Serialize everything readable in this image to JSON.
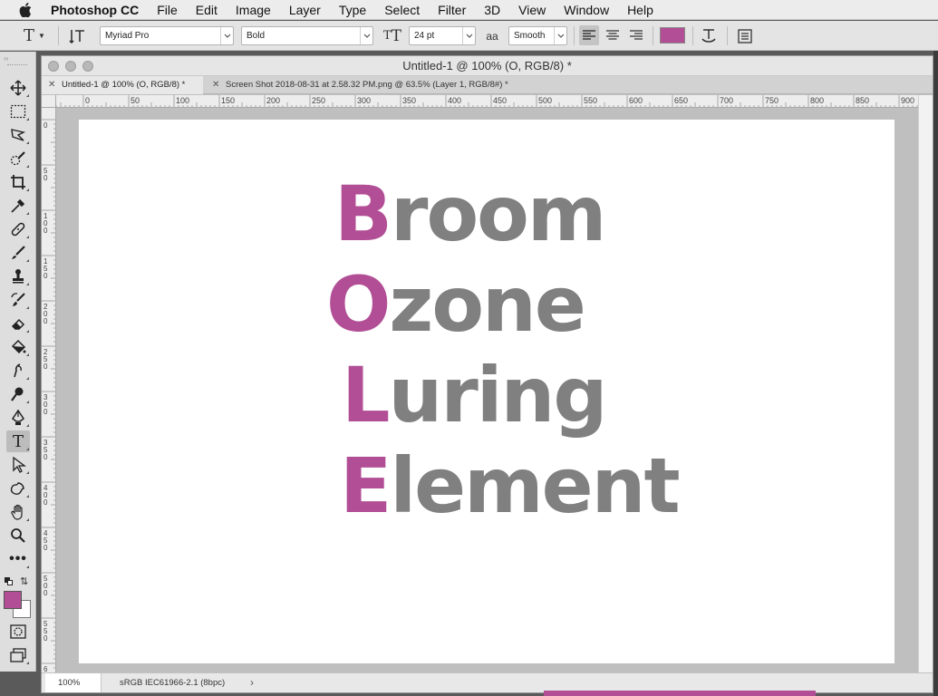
{
  "menubar": {
    "app_name": "Photoshop CC",
    "items": [
      "File",
      "Edit",
      "Image",
      "Layer",
      "Type",
      "Select",
      "Filter",
      "3D",
      "View",
      "Window",
      "Help"
    ]
  },
  "options": {
    "font_family": "Myriad Pro",
    "font_style": "Bold",
    "font_size": "24 pt",
    "antialias_icon": "aa",
    "antialias": "Smooth",
    "color": "#b24e95"
  },
  "document": {
    "window_title": "Untitled-1 @ 100% (O, RGB/8) *",
    "tabs": [
      {
        "label": "Untitled-1 @ 100% (O, RGB/8) *",
        "active": true
      },
      {
        "label": "Screen Shot 2018-08-31 at 2.58.32 PM.png @ 63.5% (Layer 1, RGB/8#) *",
        "active": false
      }
    ],
    "ruler_top_labels": [
      "0",
      "50",
      "100",
      "150",
      "200",
      "250",
      "300",
      "350",
      "400",
      "450",
      "500",
      "550",
      "600",
      "650",
      "700",
      "750",
      "800",
      "850",
      "900"
    ],
    "ruler_left_labels": [
      "0",
      "5\n0",
      "1\n0\n0",
      "1\n5\n0",
      "2\n0\n0",
      "2\n5\n0",
      "3\n0\n0",
      "3\n5\n0",
      "4\n0\n0",
      "4\n5\n0",
      "5\n0\n0",
      "5\n5\n0",
      "6"
    ],
    "words": [
      {
        "initial": "B",
        "rest": "room"
      },
      {
        "initial": "O",
        "rest": "zone"
      },
      {
        "initial": "L",
        "rest": "uring"
      },
      {
        "initial": "E",
        "rest": "lement"
      }
    ],
    "colors": {
      "initial": "#b24e95",
      "rest": "#808080"
    }
  },
  "status": {
    "zoom": "100%",
    "profile": "sRGB IEC61966-2.1 (8bpc)"
  },
  "toolbar": {
    "tools": [
      "move-tool",
      "marquee-tool",
      "lasso-tool",
      "quick-selection-tool",
      "crop-tool",
      "eyedropper-tool",
      "healing-brush-tool",
      "brush-tool",
      "clone-stamp-tool",
      "history-brush-tool",
      "eraser-tool",
      "paint-bucket-tool",
      "blur-tool",
      "dodge-tool",
      "pen-tool",
      "type-tool",
      "path-selection-tool",
      "custom-shape-tool",
      "hand-tool",
      "zoom-tool",
      "more-tools"
    ],
    "active_tool": "type-tool",
    "foreground_color": "#b24e95",
    "background_color": "#ffffff"
  }
}
